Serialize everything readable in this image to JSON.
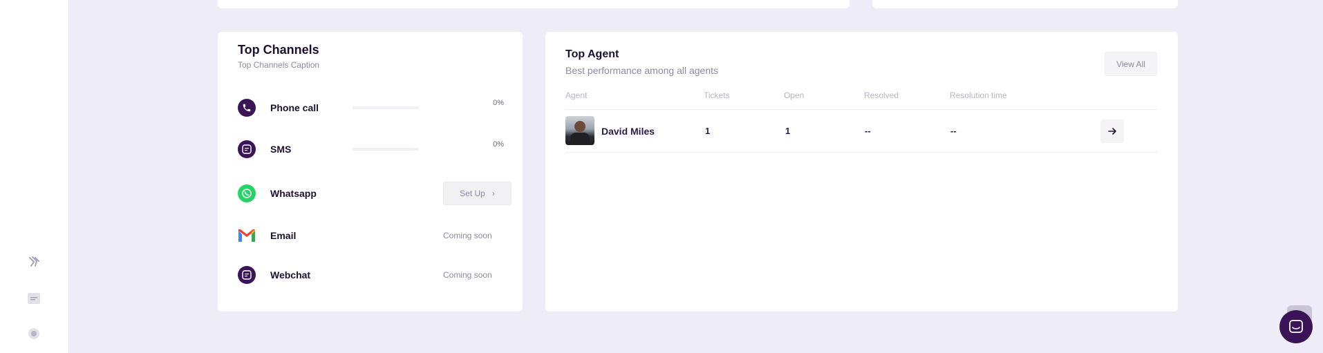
{
  "sidebar": {
    "icons": [
      "plugin-icon",
      "document-icon",
      "settings-icon"
    ]
  },
  "top_channels": {
    "title": "Top Channels",
    "caption": "Top Channels Caption",
    "channels": [
      {
        "name": "Phone call",
        "percent": "0%",
        "fill": 0
      },
      {
        "name": "SMS",
        "percent": "0%",
        "fill": 0
      },
      {
        "name": "Whatsapp",
        "action": "Set Up"
      },
      {
        "name": "Email",
        "status": "Coming soon"
      },
      {
        "name": "Webchat",
        "status": "Coming soon"
      }
    ]
  },
  "top_agent": {
    "title": "Top Agent",
    "subtitle": "Best performance among all agents",
    "view_all": "View All",
    "columns": [
      "Agent",
      "Tickets",
      "Open",
      "Resolved",
      "Resolution time"
    ],
    "rows": [
      {
        "agent": "David Miles",
        "tickets": "1",
        "open": "1",
        "resolved": "--",
        "resolution_time": "--"
      }
    ]
  },
  "colors": {
    "brand": "#3b1458",
    "whatsapp": "#25d366",
    "background": "#eeedf7"
  }
}
